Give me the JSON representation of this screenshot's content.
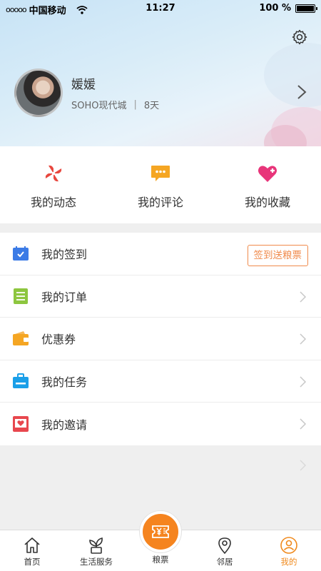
{
  "status_bar": {
    "carrier": "中国移动",
    "signal_dots": "ooooo",
    "time": "11:27",
    "battery": "100 %"
  },
  "profile": {
    "name": "媛媛",
    "community": "SOHO现代城",
    "separator": "|",
    "days": "8天"
  },
  "quick_actions": [
    {
      "label": "我的动态",
      "icon": "pinwheel-icon",
      "color": "#e8473e"
    },
    {
      "label": "我的评论",
      "icon": "comment-bubble-icon",
      "color": "#f5a623"
    },
    {
      "label": "我的收藏",
      "icon": "heart-plus-icon",
      "color": "#e8357a"
    }
  ],
  "menu": [
    {
      "label": "我的签到",
      "icon": "calendar-check-icon",
      "color": "#3b7be6",
      "action": "签到送粮票"
    },
    {
      "label": "我的订单",
      "icon": "order-list-icon",
      "color": "#8dc63f"
    },
    {
      "label": "优惠券",
      "icon": "wallet-icon",
      "color": "#f5a623"
    },
    {
      "label": "我的任务",
      "icon": "briefcase-icon",
      "color": "#1a9fe8"
    },
    {
      "label": "我的邀请",
      "icon": "invitation-heart-icon",
      "color": "#e8474e"
    }
  ],
  "tabs": [
    {
      "label": "首页",
      "icon": "home-icon"
    },
    {
      "label": "生活服务",
      "icon": "sprout-icon"
    },
    {
      "label": "粮票",
      "icon": "ticket-yen-icon"
    },
    {
      "label": "邻居",
      "icon": "location-pin-icon"
    },
    {
      "label": "我的",
      "icon": "user-circle-icon"
    }
  ],
  "colors": {
    "accent": "#f08a1d",
    "center_button": "#f5841f"
  }
}
